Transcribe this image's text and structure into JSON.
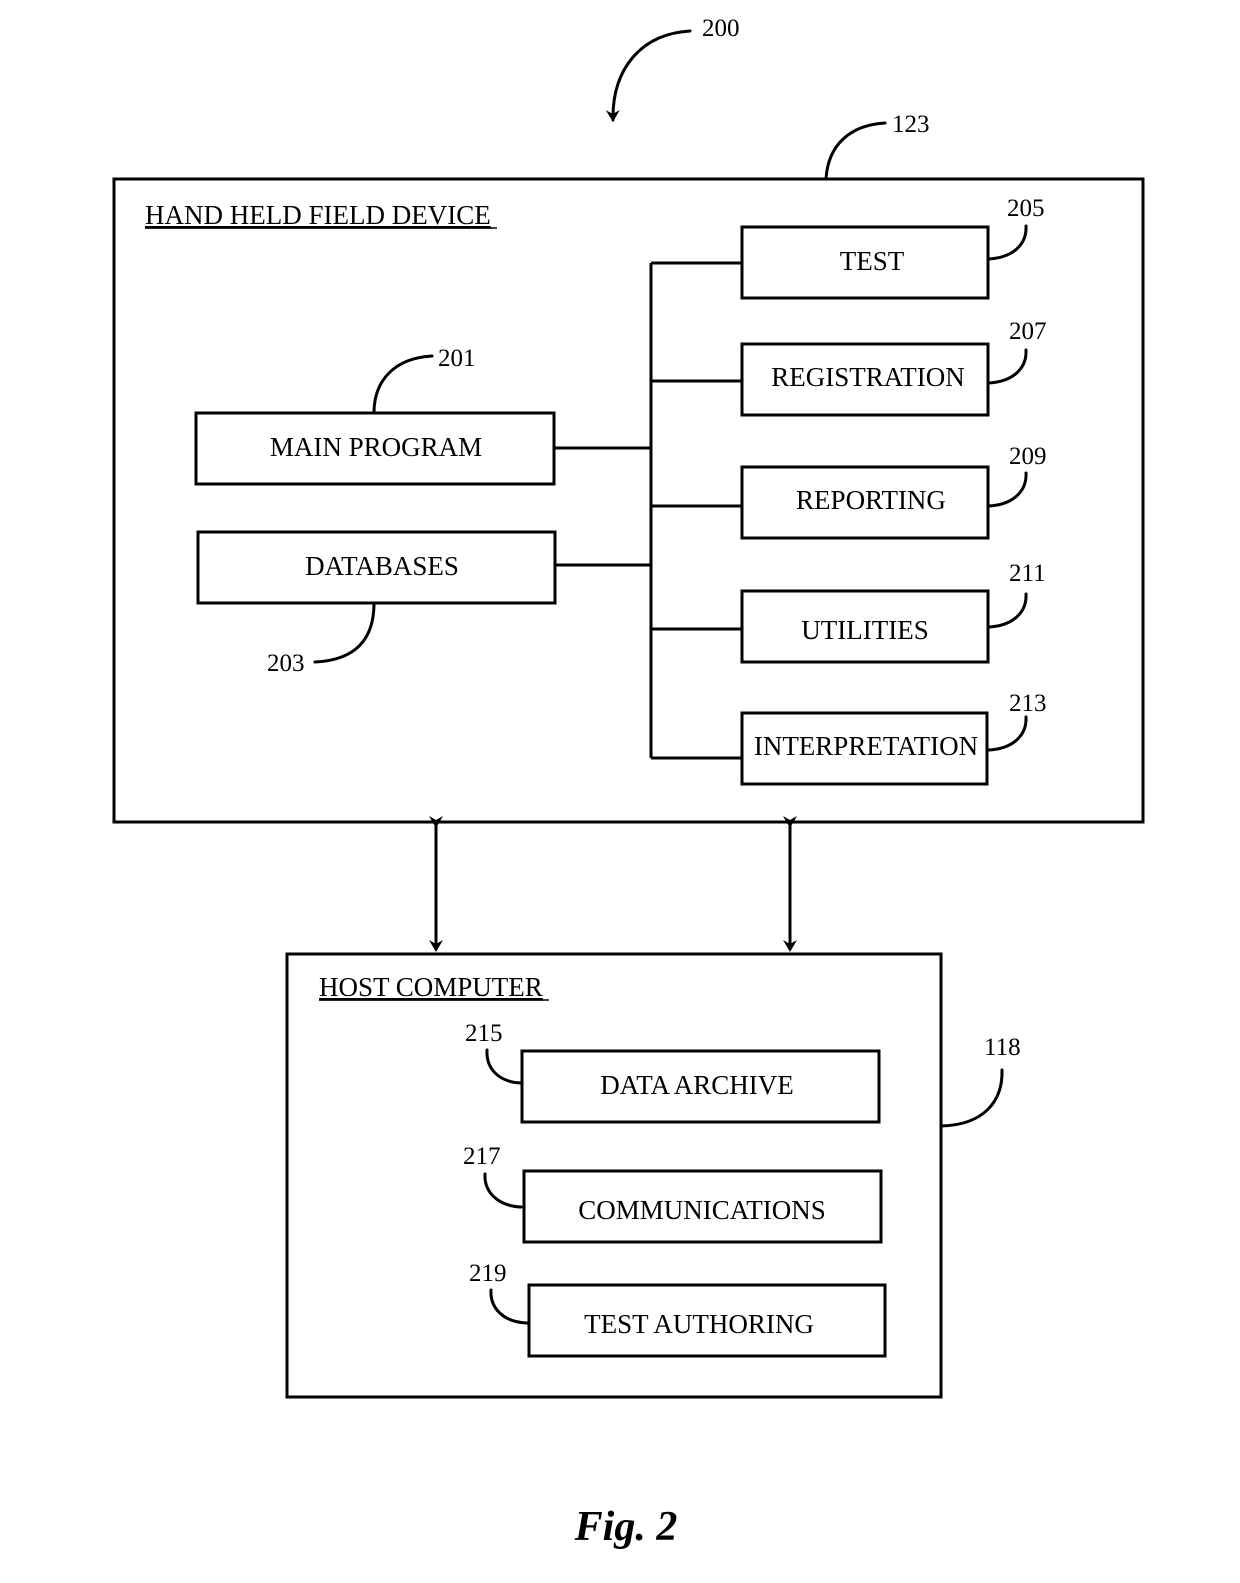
{
  "figure": {
    "caption": "Fig. 2",
    "ref": "200"
  },
  "device": {
    "title": "HAND HELD FIELD DEVICE",
    "ref": "123",
    "left_modules": [
      {
        "label": "MAIN PROGRAM",
        "ref": "201"
      },
      {
        "label": "DATABASES",
        "ref": "203"
      }
    ],
    "right_modules": [
      {
        "label": "TEST",
        "ref": "205"
      },
      {
        "label": "REGISTRATION",
        "ref": "207"
      },
      {
        "label": "REPORTING",
        "ref": "209"
      },
      {
        "label": "UTILITIES",
        "ref": "211"
      },
      {
        "label": "INTERPRETATION",
        "ref": "213"
      }
    ]
  },
  "host": {
    "title": "HOST COMPUTER",
    "ref": "118",
    "modules": [
      {
        "label": "DATA ARCHIVE",
        "ref": "215"
      },
      {
        "label": "COMMUNICATIONS",
        "ref": "217"
      },
      {
        "label": "TEST AUTHORING",
        "ref": "219"
      }
    ]
  },
  "connections": [
    {
      "from": "HAND HELD FIELD DEVICE",
      "to": "HOST COMPUTER",
      "type": "bidirectional"
    },
    {
      "from": "HAND HELD FIELD DEVICE",
      "to": "HOST COMPUTER",
      "type": "bidirectional"
    }
  ]
}
